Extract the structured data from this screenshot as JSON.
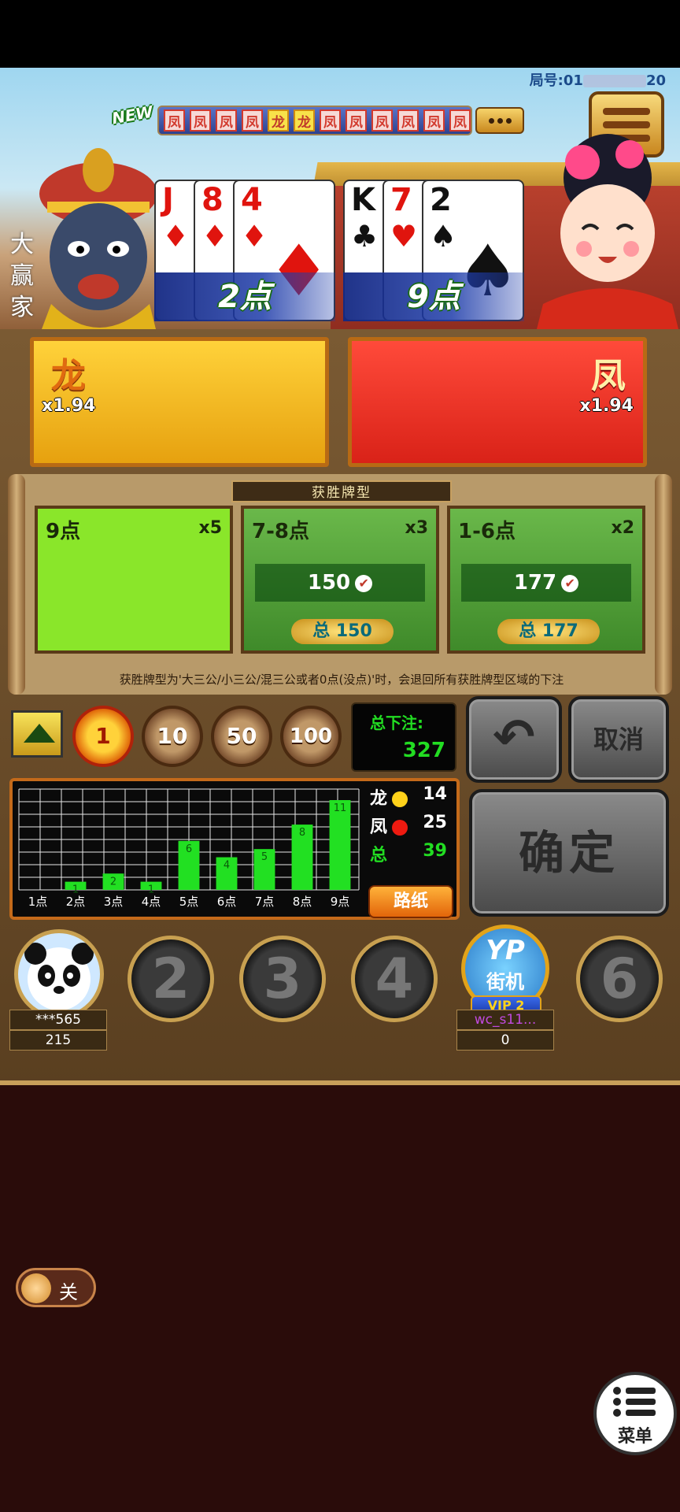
{
  "round": {
    "label": "局号:01",
    "suffix": "20"
  },
  "history": {
    "new_badge": "NEW",
    "results": [
      "凤",
      "凤",
      "凤",
      "凤",
      "龙",
      "龙",
      "凤",
      "凤",
      "凤",
      "凤",
      "凤",
      "凤"
    ]
  },
  "banker_label": "大赢家",
  "hands": {
    "dragon": {
      "cards": [
        {
          "rank": "J",
          "suit": "♦"
        },
        {
          "rank": "8",
          "suit": "♦"
        },
        {
          "rank": "4",
          "suit": "♦"
        }
      ],
      "points": "2点"
    },
    "phoenix": {
      "cards": [
        {
          "rank": "K",
          "suit": "♣"
        },
        {
          "rank": "7",
          "suit": "♥"
        },
        {
          "rank": "2",
          "suit": "♠"
        }
      ],
      "points": "9点"
    }
  },
  "sides": {
    "dragon": {
      "name": "龙",
      "odds": "x1.94"
    },
    "phoenix": {
      "name": "凤",
      "odds": "x1.94"
    }
  },
  "win_types": {
    "title": "获胜牌型",
    "boxes": [
      {
        "label": "9点",
        "mult": "x5",
        "stake": "",
        "total": ""
      },
      {
        "label": "7-8点",
        "mult": "x3",
        "stake": "150",
        "total": "总 150"
      },
      {
        "label": "1-6点",
        "mult": "x2",
        "stake": "177",
        "total": "总 177"
      }
    ],
    "note": "获胜牌型为'大三公/小三公/混三公或者0点(没点)'时，会退回所有获胜牌型区域的下注"
  },
  "chips": [
    "1",
    "10",
    "50",
    "100"
  ],
  "selected_chip": "1",
  "total_bet": {
    "label": "总下注:",
    "value": "327"
  },
  "buttons": {
    "cancel": "取消",
    "confirm": "确定",
    "road": "路纸"
  },
  "trend": {
    "labels": [
      "1点",
      "2点",
      "3点",
      "4点",
      "5点",
      "6点",
      "7点",
      "8点",
      "9点"
    ],
    "counts": [
      0,
      1,
      2,
      1,
      6,
      4,
      5,
      8,
      11
    ],
    "max": 11
  },
  "stats": {
    "dragon_label": "龙",
    "dragon": "14",
    "phoenix_label": "凤",
    "phoenix": "25",
    "total_label": "总",
    "total": "39"
  },
  "seats": {
    "me": {
      "name": "***565",
      "score": "215"
    },
    "empty": [
      "2",
      "3",
      "4",
      "6"
    ],
    "vip": {
      "line1": "YP",
      "line2": "街机",
      "badge": "VIP 2",
      "name": "wc_s11...",
      "score": "0"
    }
  },
  "chat_toggle": "关",
  "menu_label": "菜单",
  "colors": {
    "dragon": "#ffc20e",
    "phoenix": "#ff2e1f",
    "bar": "#22e022"
  }
}
